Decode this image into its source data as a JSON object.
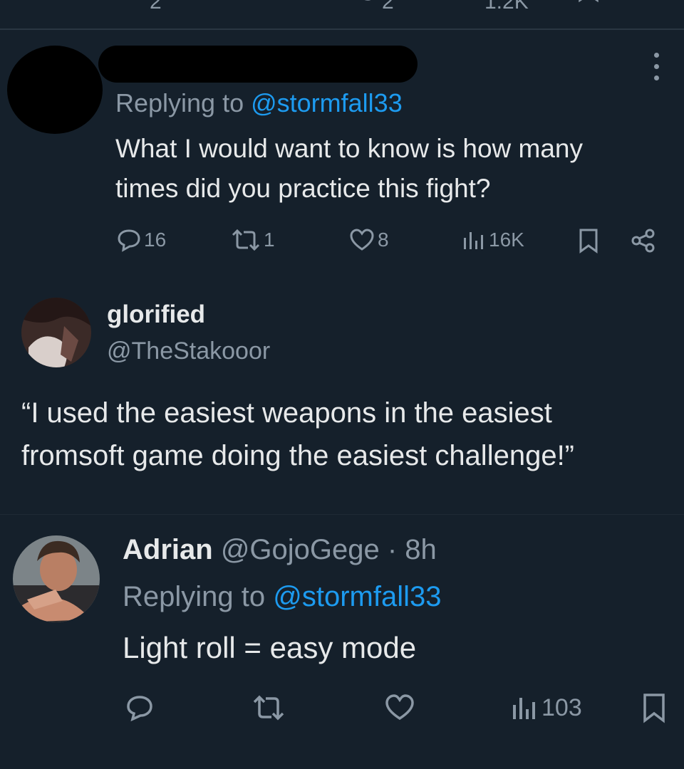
{
  "top_actions": {
    "replies": "2",
    "likes": "2",
    "views": "1.2K"
  },
  "reply1": {
    "replying_prefix": "Replying to ",
    "replying_handle": "@stormfall33",
    "text_line1": "What I would want to know is how many",
    "text_line2": "times did you practice this fight?",
    "replies": "16",
    "reposts": "1",
    "likes": "8",
    "views": "16K"
  },
  "quote": {
    "name": "glorified",
    "handle": "@TheStakooor",
    "text_line1": "“I used the easiest weapons in the easiest",
    "text_line2": "fromsoft game doing the easiest challenge!”"
  },
  "reply2": {
    "name": "Adrian",
    "handle_time": "@GojoGege · 8h",
    "replying_prefix": "Replying to ",
    "replying_handle": "@stormfall33",
    "text": "Light roll = easy mode",
    "views": "103"
  },
  "colors": {
    "background": "#15202b",
    "text": "#e7e9ea",
    "muted": "#8b98a5",
    "link": "#1d9bf0"
  }
}
